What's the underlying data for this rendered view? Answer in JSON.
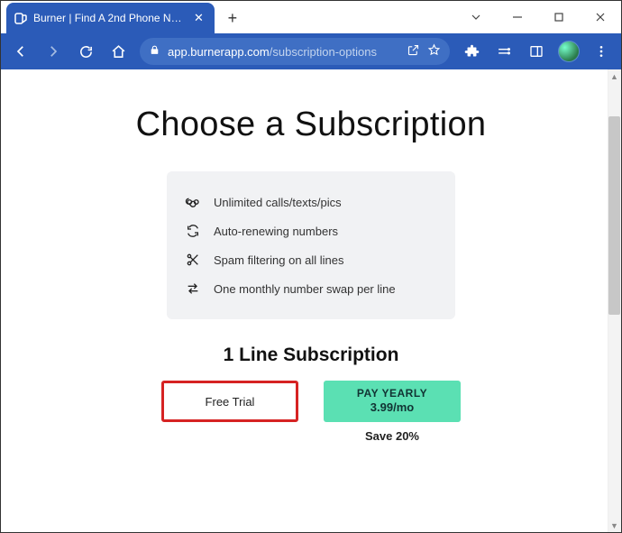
{
  "window": {
    "tab_title": "Burner | Find A 2nd Phone Numb",
    "url_domain": "app.burnerapp.com",
    "url_path": "/subscription-options"
  },
  "page": {
    "title": "Choose a Subscription",
    "features": [
      "Unlimited calls/texts/pics",
      "Auto-renewing numbers",
      "Spam filtering on all lines",
      "One monthly number swap per line"
    ],
    "sub_heading": "1 Line Subscription",
    "free_trial_label": "Free Trial",
    "yearly_label_line1": "PAY YEARLY",
    "yearly_label_line2": "3.99/mo",
    "save_text": "Save 20%"
  }
}
